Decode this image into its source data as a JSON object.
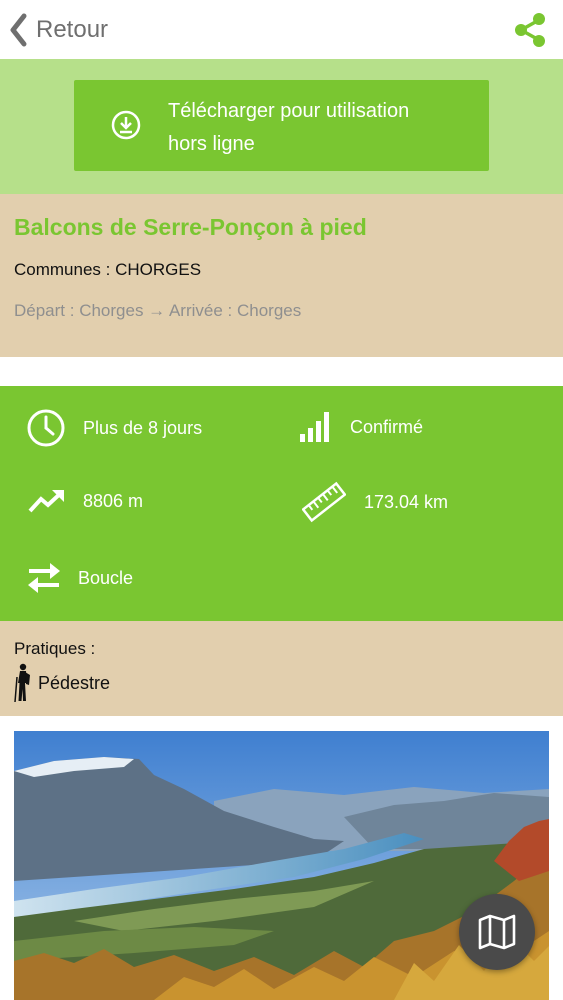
{
  "header": {
    "back_label": "Retour"
  },
  "download": {
    "line1": "Télécharger pour utilisation",
    "line2": "hors ligne"
  },
  "trail": {
    "title": "Balcons de Serre-Ponçon à pied",
    "communes": "Communes : CHORGES",
    "route": "Départ : Chorges → Arrivée : Chorges"
  },
  "stats": {
    "duration": "Plus de 8 jours",
    "difficulty": "Confirmé",
    "elevation": "8806 m",
    "distance": "173.04 km",
    "route_type": "Boucle"
  },
  "practices": {
    "label": "Pratiques :",
    "items": [
      "Pédestre"
    ]
  },
  "colors": {
    "brand_green": "#7ac631",
    "light_green": "#b6e08a",
    "sand": "#e2cfae"
  }
}
